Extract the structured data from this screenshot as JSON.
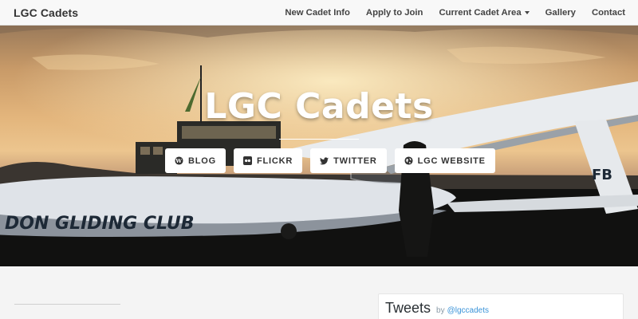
{
  "navbar": {
    "brand": "LGC Cadets",
    "links": [
      {
        "label": "New Cadet Info"
      },
      {
        "label": "Apply to Join"
      },
      {
        "label": "Current Cadet Area"
      },
      {
        "label": "Gallery"
      },
      {
        "label": "Contact"
      }
    ]
  },
  "hero": {
    "title": "LGC Cadets",
    "fuselage_text": "DON GLIDING CLUB",
    "tail_text": "FB",
    "buttons": [
      {
        "label": "BLOG",
        "icon": "wordpress-icon"
      },
      {
        "label": "FLICKR",
        "icon": "flickr-icon"
      },
      {
        "label": "TWITTER",
        "icon": "twitter-icon"
      },
      {
        "label": "LGC WEBSITE",
        "icon": "globe-icon"
      }
    ]
  },
  "tweets": {
    "title": "Tweets",
    "by": "by",
    "handle": "@lgccadets"
  },
  "colors": {
    "navbar_bg": "#f8f8f8",
    "link": "#3b94d9",
    "hero_text": "#ffffff"
  }
}
